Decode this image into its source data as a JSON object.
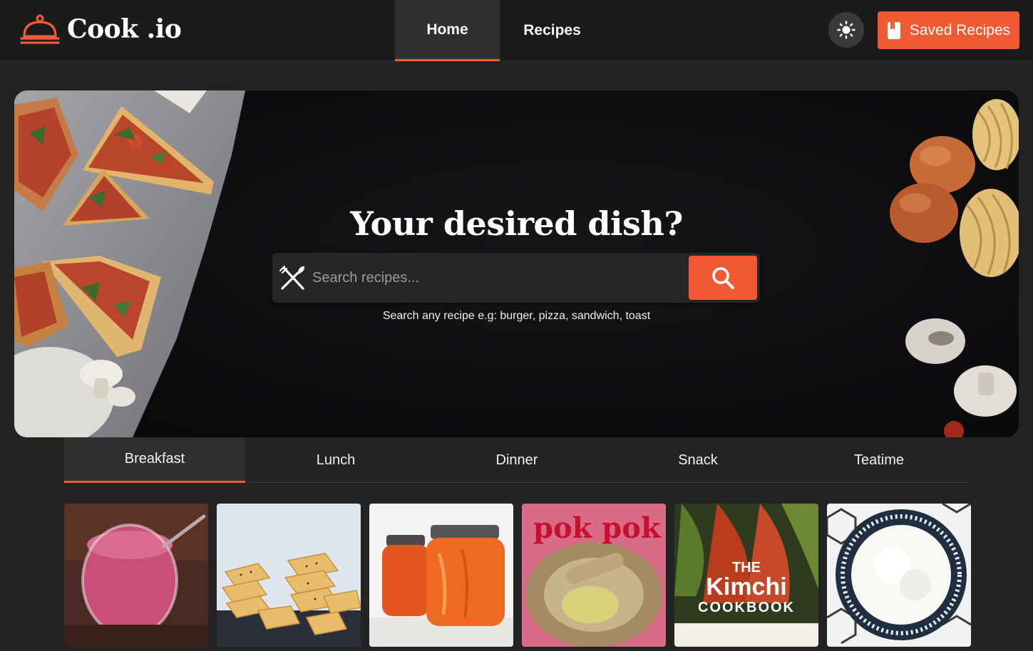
{
  "header": {
    "logo_text": "Cook .io",
    "nav": [
      {
        "label": "Home",
        "active": true
      },
      {
        "label": "Recipes",
        "active": false
      }
    ],
    "theme_toggle_icon": "sun-icon",
    "saved_button": {
      "label": "Saved Recipes",
      "icon": "bookmark-icon"
    }
  },
  "hero": {
    "title": "Your desired dish?",
    "search": {
      "icon": "utensils-icon",
      "placeholder": "Search recipes...",
      "button_icon": "search-icon"
    },
    "hint": "Search any recipe e.g: burger, pizza, sandwich, toast"
  },
  "tabs": [
    {
      "label": "Breakfast",
      "active": true
    },
    {
      "label": "Lunch",
      "active": false
    },
    {
      "label": "Dinner",
      "active": false
    },
    {
      "label": "Snack",
      "active": false
    },
    {
      "label": "Teatime",
      "active": false
    }
  ],
  "cards": [
    {
      "image": "berry-smoothie"
    },
    {
      "image": "seeded-crackers"
    },
    {
      "image": "marmalade-jars"
    },
    {
      "image": "pok-pok-cookbook",
      "text": "pok pok"
    },
    {
      "image": "kimchi-cookbook",
      "text": "THE Kimchi COOKBOOK"
    },
    {
      "image": "rice-bowl"
    }
  ],
  "colors": {
    "accent": "#f25a36",
    "background": "#232323",
    "header": "#1b1b1b"
  }
}
